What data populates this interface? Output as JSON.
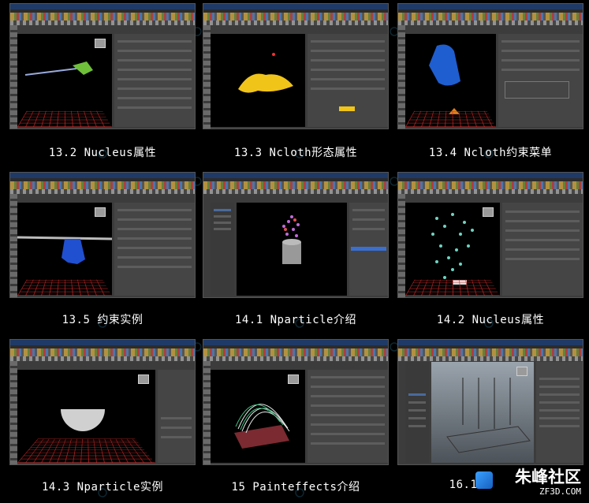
{
  "thumbnails": [
    {
      "caption": "13.2 Nucleus属性",
      "scene": "nucleus"
    },
    {
      "caption": "13.3 Ncloth形态属性",
      "scene": "cloth-yellow"
    },
    {
      "caption": "13.4 Ncloth约束菜单",
      "scene": "cloth-blue"
    },
    {
      "caption": "13.5 约束实例",
      "scene": "cloth-constraint"
    },
    {
      "caption": "14.1 Nparticle介绍",
      "scene": "particles-cylinder"
    },
    {
      "caption": "14.2 Nucleus属性",
      "scene": "particles-cloud"
    },
    {
      "caption": "14.3 Nparticle实例",
      "scene": "sphere"
    },
    {
      "caption": "15 Painteffects介绍",
      "scene": "strokes"
    },
    {
      "caption": "16.1.",
      "scene": "grey-viewport"
    }
  ],
  "watermark": {
    "name": "朱峰社区",
    "domain": "ZF3D.COM"
  },
  "colors": {
    "background": "#000000",
    "caption": "#ffffff"
  }
}
